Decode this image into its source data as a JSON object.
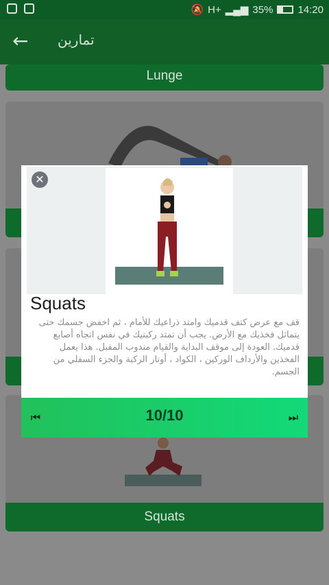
{
  "status_bar": {
    "network": "H+",
    "battery": "35%",
    "time": "14:20",
    "battery_level": 0.35
  },
  "app_bar": {
    "title": "تمارين",
    "back_icon": "arrow-left-icon"
  },
  "cards": [
    {
      "label": "Lunge"
    },
    {
      "label": ""
    },
    {
      "label": ""
    },
    {
      "label": "Squats"
    }
  ],
  "dialog": {
    "close_icon": "close-icon",
    "title": "Squats",
    "description": "قف مع عرض كتف قدميك وامتد ذراعيك للأمام ، ثم اخفض جسمك حتى يتماثل فخذيك مع الأرض. يجب أن تمتد ركبتيك في نفس اتجاه أصابع قدميك. العودة إلى موقف البداية والقيام مندوب المقبل. هذا يعمل الفخذين والأرداف الوركين ، الكواد ، أوتار الركبة والجزء السفلي من الجسم.",
    "counter": "10/10",
    "prev_icon": "skip-previous-icon",
    "next_icon": "skip-next-icon"
  },
  "colors": {
    "app_bar": "#125f28",
    "card_label": "#0f6b2c",
    "footer_start": "#21c15b",
    "footer_end": "#13d978"
  }
}
